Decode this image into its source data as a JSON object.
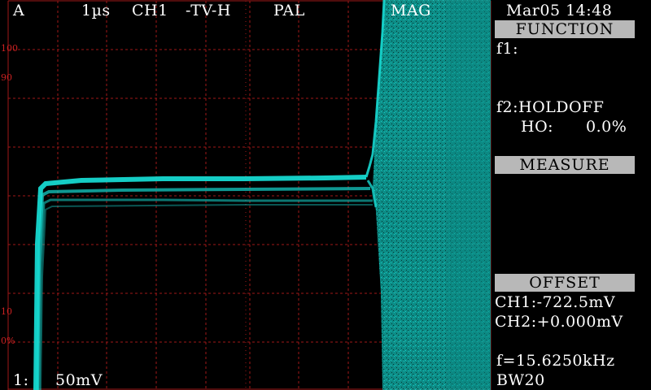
{
  "top_bar": {
    "trigger_mode": "A",
    "timebase": "1µs",
    "channel": "CH1",
    "trigger_source": "-TV-H",
    "tv_standard": "PAL",
    "mag": "MAG"
  },
  "datetime": "Mar05 14:48",
  "graticule_labels": [
    "100",
    "90",
    "10",
    "0%"
  ],
  "bottom_bar": {
    "channel_index": "1:",
    "volts_per_div": "50mV"
  },
  "function_panel": {
    "header": "FUNCTION",
    "f1": "f1:",
    "f2": "f2:HOLDOFF",
    "holdoff_label": "HO:",
    "holdoff_value": "0.0%"
  },
  "measure_panel": {
    "header": "MEASURE"
  },
  "offset_panel": {
    "header": "OFFSET",
    "ch1": "CH1:-722.5mV",
    "ch2": "CH2:+0.000mV"
  },
  "frequency": "f=15.6250kHz",
  "bandwidth": "BW20",
  "colors": {
    "trace": "#16d8d0",
    "grid": "#a01818",
    "panel_header_bg": "#b8b8b8",
    "text": "#ffffff"
  }
}
